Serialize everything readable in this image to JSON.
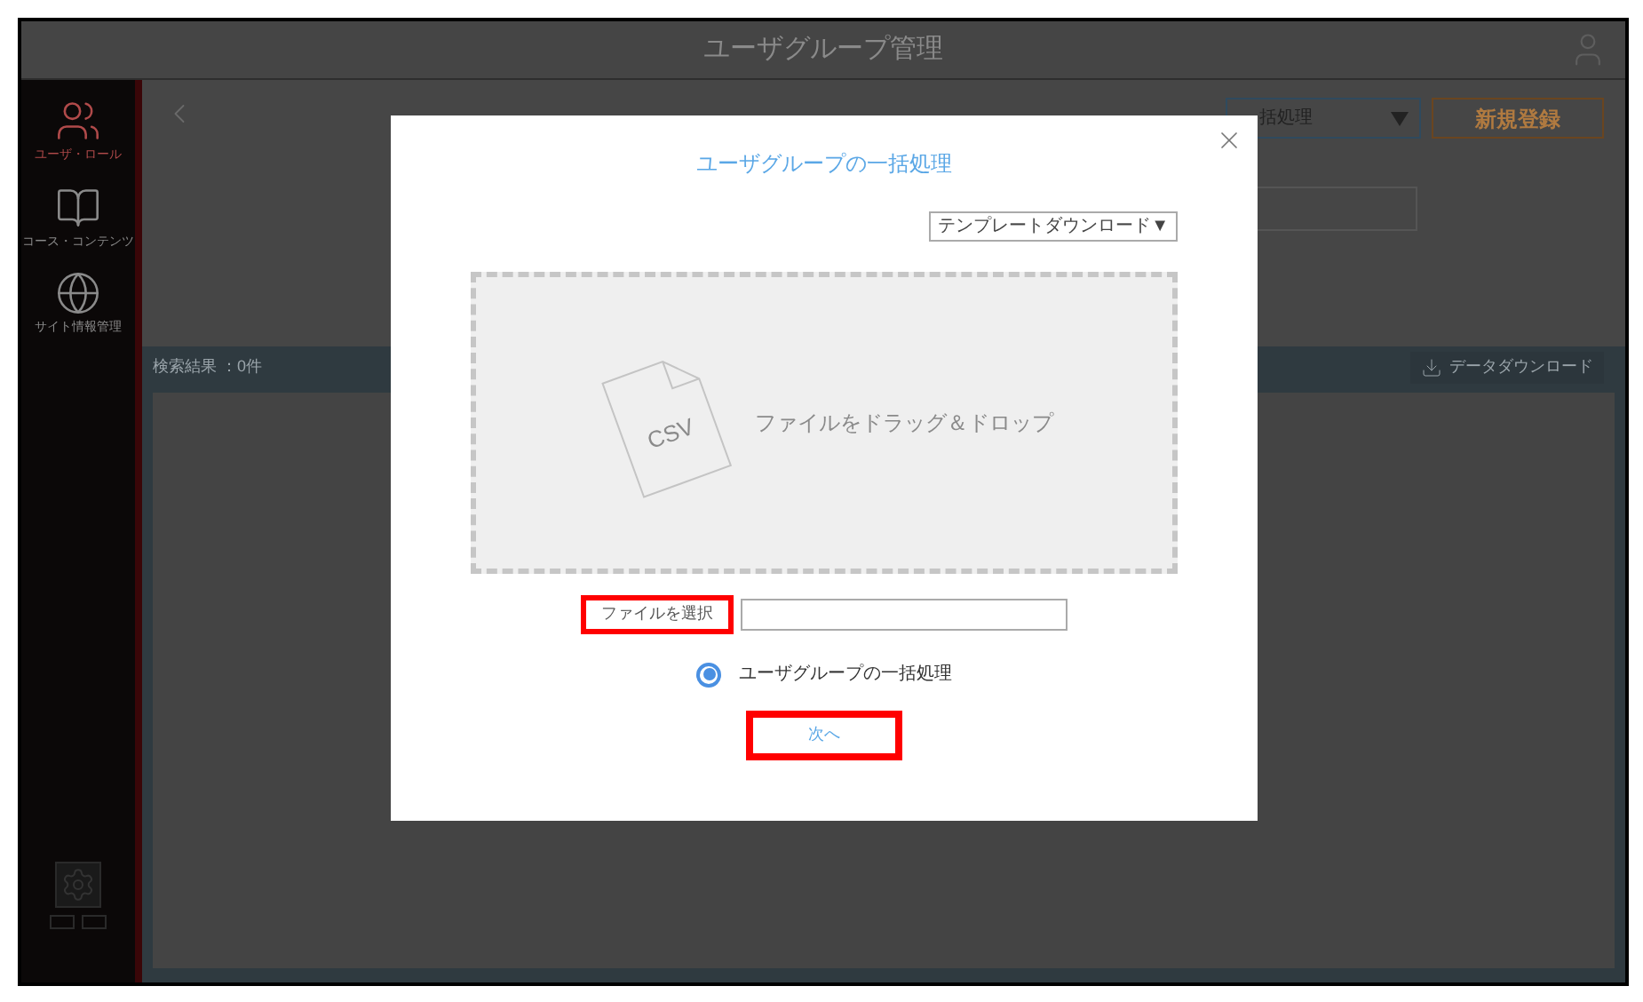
{
  "header": {
    "title": "ユーザグループ管理"
  },
  "sidebar": {
    "items": [
      {
        "label": "ユーザ・ロール",
        "selected": true
      },
      {
        "label": "コース・コンテンツ",
        "selected": false
      },
      {
        "label": "サイト情報管理",
        "selected": false
      }
    ]
  },
  "toolbar": {
    "select_value": "括処理",
    "new_button": "新規登録"
  },
  "results": {
    "count_text": "検索結果 ：0件",
    "download_button": "データダウンロード"
  },
  "dialog": {
    "title": "ユーザグループの一括処理",
    "template_dropdown": "テンプレートダウンロード▼",
    "drop_zone": {
      "file_type": "CSV",
      "hint": "ファイルをドラッグ＆ドロップ"
    },
    "file_button": {
      "label": "ファイルを選択",
      "highlighted": true
    },
    "radios": [
      {
        "label": "ユーザグループの一括処理",
        "selected": true
      }
    ],
    "next_button": {
      "label": "次へ",
      "highlighted": true
    }
  }
}
